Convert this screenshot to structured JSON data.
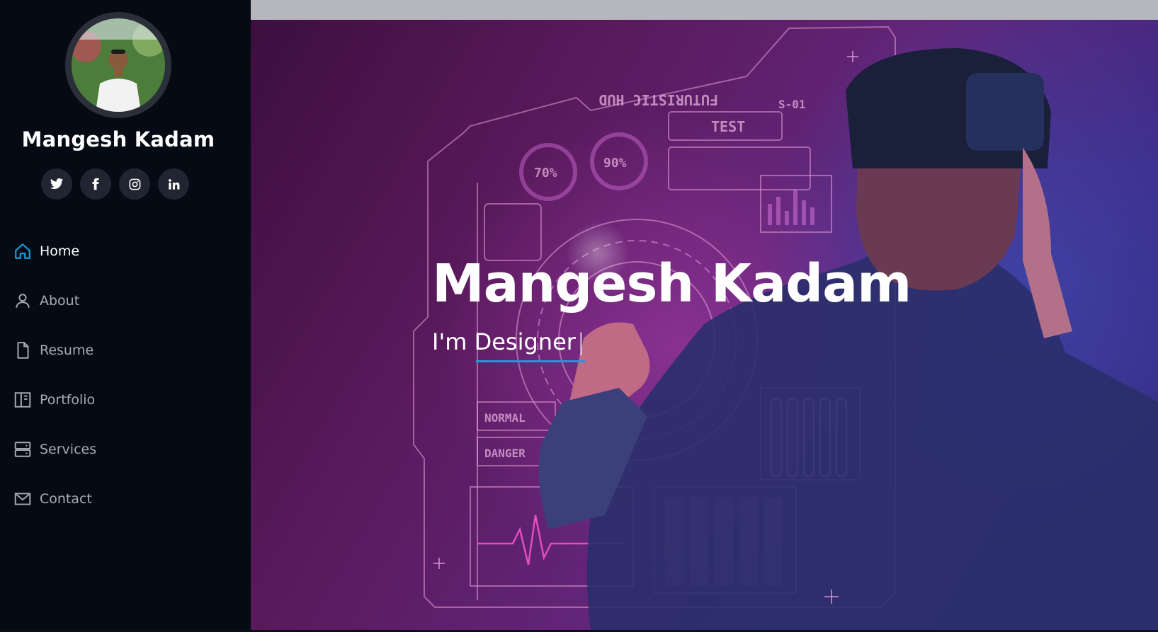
{
  "profile": {
    "name": "Mangesh Kadam",
    "avatar_alt": "profile-photo"
  },
  "social": [
    {
      "name": "twitter",
      "icon": "twitter-icon"
    },
    {
      "name": "facebook",
      "icon": "facebook-icon"
    },
    {
      "name": "instagram",
      "icon": "instagram-icon"
    },
    {
      "name": "linkedin",
      "icon": "linkedin-icon"
    }
  ],
  "nav": {
    "items": [
      {
        "label": "Home",
        "icon": "home-icon",
        "active": true
      },
      {
        "label": "About",
        "icon": "user-icon",
        "active": false
      },
      {
        "label": "Resume",
        "icon": "file-icon",
        "active": false
      },
      {
        "label": "Portfolio",
        "icon": "layout-icon",
        "active": false
      },
      {
        "label": "Services",
        "icon": "server-icon",
        "active": false
      },
      {
        "label": "Contact",
        "icon": "envelope-icon",
        "active": false
      }
    ]
  },
  "hero": {
    "title": "Mangesh Kadam",
    "prefix": "I'm",
    "typed_word": "Designer",
    "cursor": "|",
    "hud_labels": {
      "futuristic": "FUTURISTIC HUD",
      "test": "TEST",
      "code": "S-01",
      "gauge1": "70%",
      "gauge2": "90%",
      "normal": "NORMAL",
      "danger": "DANGER"
    }
  },
  "colors": {
    "accent": "#149ddd",
    "sidebar_bg": "#040b14",
    "social_bg": "#212431",
    "nav_text": "#a8a9b4"
  }
}
